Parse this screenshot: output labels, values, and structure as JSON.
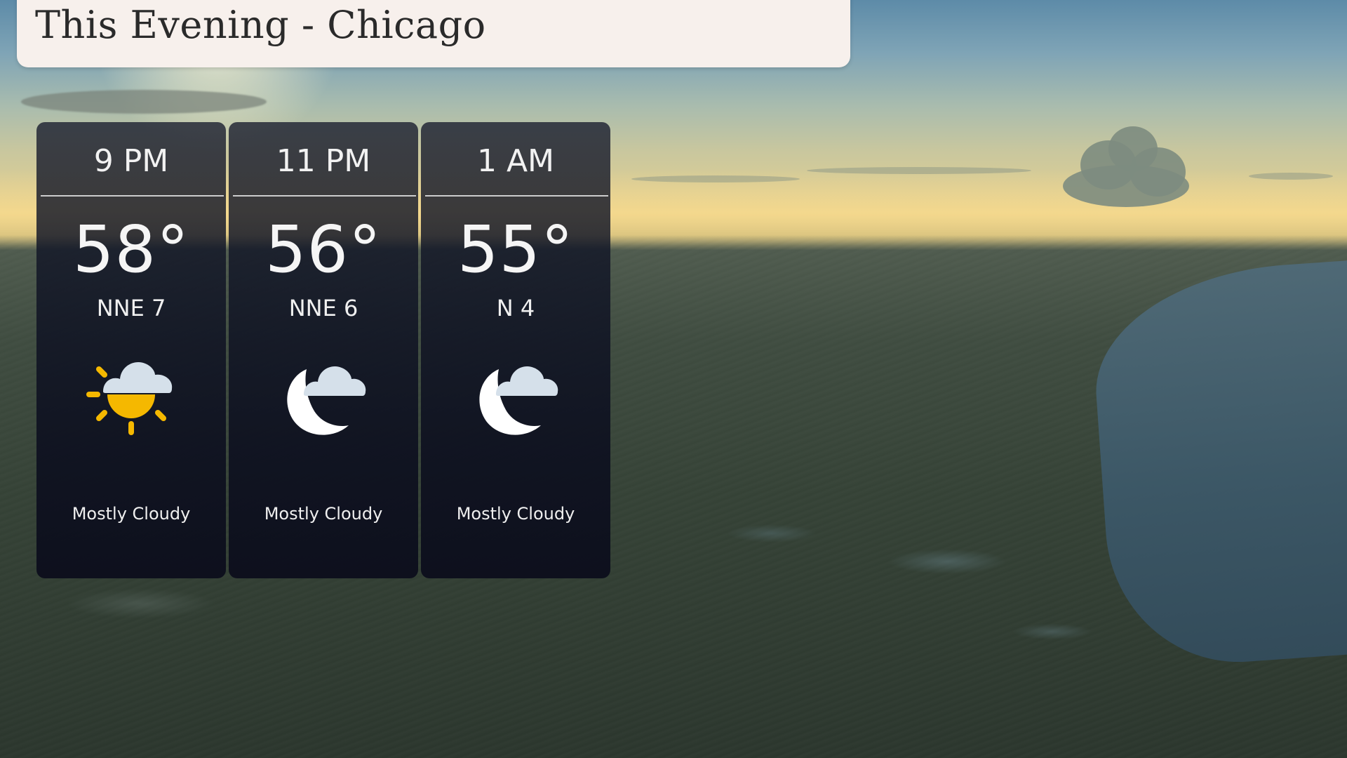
{
  "header": {
    "title": "This Evening - Chicago"
  },
  "forecast": [
    {
      "time": "9 PM",
      "temperature": "58°",
      "wind": "NNE 7",
      "condition": "Mostly Cloudy",
      "icon": "partly-cloudy-day-icon"
    },
    {
      "time": "11 PM",
      "temperature": "56°",
      "wind": "NNE 6",
      "condition": "Mostly Cloudy",
      "icon": "partly-cloudy-night-icon"
    },
    {
      "time": "1 AM",
      "temperature": "55°",
      "wind": "N 4",
      "condition": "Mostly Cloudy",
      "icon": "partly-cloudy-night-icon"
    }
  ],
  "colors": {
    "banner_bg": "#f7f0ec",
    "card_bg": "#12162a",
    "sun": "#f5b800",
    "cloud": "#d5e0ea",
    "moon": "#ffffff"
  }
}
